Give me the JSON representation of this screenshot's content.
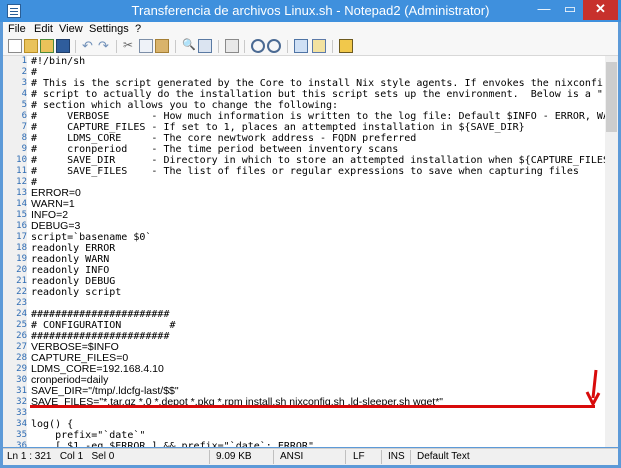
{
  "window": {
    "title": "Transferencia de archivos Linux.sh - Notepad2 (Administrator)",
    "min_label": "—",
    "max_label": "▭",
    "close_label": "✕"
  },
  "menu": [
    "File",
    "Edit",
    "View",
    "Settings",
    "?"
  ],
  "toolbar": [
    "new-icon",
    "open-icon",
    "browse-icon",
    "save-icon",
    "undo-icon",
    "redo-icon",
    "cut-icon",
    "copy-icon",
    "paste-icon",
    "find-icon",
    "replace-icon",
    "word-wrap-icon",
    "zoom-in-icon",
    "zoom-out-icon",
    "schemes-icon",
    "customize-icon",
    "exit-icon"
  ],
  "lines": [
    {
      "n": "1",
      "text": "#!/bin/sh"
    },
    {
      "n": "2",
      "text": "#"
    },
    {
      "n": "3",
      "text": "# This is the script generated by the Core to install Nix style agents. If envokes the nixconfi"
    },
    {
      "n": "4",
      "text": "# script to actually do the installation but this script sets up the environment.  Below is a \""
    },
    {
      "n": "5",
      "text": "# section which allows you to change the following:"
    },
    {
      "n": "6",
      "text": "#     VERBOSE       - How much information is written to the log file: Default $INFO - ERROR, WA"
    },
    {
      "n": "7",
      "text": "#     CAPTURE_FILES - If set to 1, places an attempted installation in ${SAVE_DIR}"
    },
    {
      "n": "8",
      "text": "#     LDMS_CORE     - The core newtwork address - FQDN preferred"
    },
    {
      "n": "9",
      "text": "#     cronperiod    - The time period between inventory scans"
    },
    {
      "n": "10",
      "text": "#     SAVE_DIR      - Directory in which to store an attempted installation when ${CAPTURE_FILES"
    },
    {
      "n": "11",
      "text": "#     SAVE_FILES    - The list of files or regular expressions to save when capturing files"
    },
    {
      "n": "12",
      "text": "#"
    },
    {
      "n": "13",
      "text": "ERROR=0"
    },
    {
      "n": "14",
      "text": "WARN=1"
    },
    {
      "n": "15",
      "text": "INFO=2"
    },
    {
      "n": "16",
      "text": "DEBUG=3"
    },
    {
      "n": "17",
      "text": "script=`basename $0`"
    },
    {
      "n": "18",
      "text": "readonly ERROR"
    },
    {
      "n": "19",
      "text": "readonly WARN"
    },
    {
      "n": "20",
      "text": "readonly INFO"
    },
    {
      "n": "21",
      "text": "readonly DEBUG"
    },
    {
      "n": "22",
      "text": "readonly script"
    },
    {
      "n": "23",
      "text": ""
    },
    {
      "n": "24",
      "text": "#######################"
    },
    {
      "n": "25",
      "text": "# CONFIGURATION        #"
    },
    {
      "n": "26",
      "text": "#######################"
    },
    {
      "n": "27",
      "text": "VERBOSE=$INFO"
    },
    {
      "n": "28",
      "text": "CAPTURE_FILES=0"
    },
    {
      "n": "29",
      "text": "LDMS_CORE=192.168.4.10"
    },
    {
      "n": "30",
      "text": "cronperiod=daily"
    },
    {
      "n": "31",
      "text": "SAVE_DIR=\"/tmp/.ldcfg-last/$$\""
    },
    {
      "n": "32",
      "text": "SAVE_FILES=\"*.tar.gz *.0 *.depot *.pkg *.rpm install.sh nixconfig.sh .ld-sleeper.sh wget*\""
    },
    {
      "n": "33",
      "text": ""
    },
    {
      "n": "34",
      "text": "log() {"
    },
    {
      "n": "35",
      "text": "    prefix=\"`date`\""
    },
    {
      "n": "36",
      "text": "    [ $1 -eq $ERROR ] && prefix=\"`date`: ERROR\""
    }
  ],
  "status": {
    "position": "Ln 1 : 321   Col 1   Sel 0",
    "size": "9.09 KB",
    "encoding": "ANSI",
    "eol": "LF",
    "ins": "INS",
    "scheme": "Default Text"
  },
  "colors": {
    "annotation": "#d80b0b",
    "line_numbers": "#2d6bb3",
    "titlebar": "#3f90dd"
  }
}
